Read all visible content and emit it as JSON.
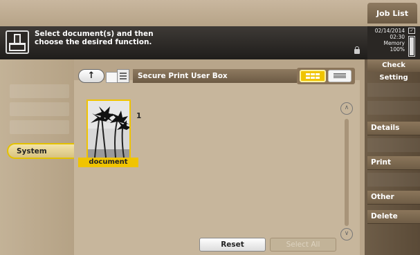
{
  "header": {
    "job_list_label": "Job List",
    "message_line1": "Select document(s) and then",
    "message_line2": "choose the desired function.",
    "date": "02/14/2014",
    "time": "02:30",
    "memory_label": "Memory",
    "memory_value": "100%"
  },
  "left_panel": {
    "active_tab": "System"
  },
  "main": {
    "box_title": "Secure Print User Box",
    "view_modes": [
      "thumbnail",
      "list"
    ],
    "active_view": "thumbnail",
    "documents": [
      {
        "name": "document",
        "index": "1"
      }
    ],
    "reset_label": "Reset",
    "select_all_label": "Select All"
  },
  "right_panel": {
    "check_setting_label": "Check Setting",
    "details_label": "Details",
    "print_label": "Print",
    "other_label": "Other",
    "delete_label": "Delete"
  },
  "colors": {
    "accent": "#f0c400",
    "panel_bg": "#b8a58a",
    "button_brown": "#7a6650",
    "message_bar": "#2a2724"
  }
}
